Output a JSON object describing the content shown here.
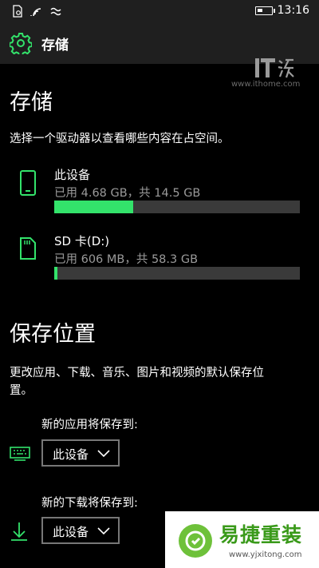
{
  "status_bar": {
    "time": "13:16"
  },
  "header": {
    "title": "存储"
  },
  "watermark": {
    "logo_text": "IT之家",
    "url": "www.ithome.com"
  },
  "storage": {
    "heading": "存储",
    "description": "选择一个驱动器以查看哪些内容在占空间。",
    "items": [
      {
        "name": "此设备",
        "usage": "已用 4.68 GB，共 14.5 GB",
        "used_fraction": 0.32,
        "icon": "phone-icon"
      },
      {
        "name": "SD 卡(D:)",
        "usage": "已用 606 MB，共 58.3 GB",
        "used_fraction": 0.012,
        "icon": "sd-card-icon"
      }
    ]
  },
  "save_locations": {
    "heading": "保存位置",
    "description_line1": "更改应用、下载、音乐、图片和视频的默认保存位",
    "description_line2": "置。",
    "apps_label": "新的应用将保存到:",
    "apps_value": "此设备",
    "downloads_label": "新的下载将保存到:",
    "downloads_value": "此设备"
  },
  "bottom_logo": {
    "text": "易捷重装",
    "url": "www.yjxitong.com"
  },
  "colors": {
    "accent": "#33e36b",
    "bar_bg": "#3a3a3a",
    "sub_text": "#9a9a9a"
  }
}
